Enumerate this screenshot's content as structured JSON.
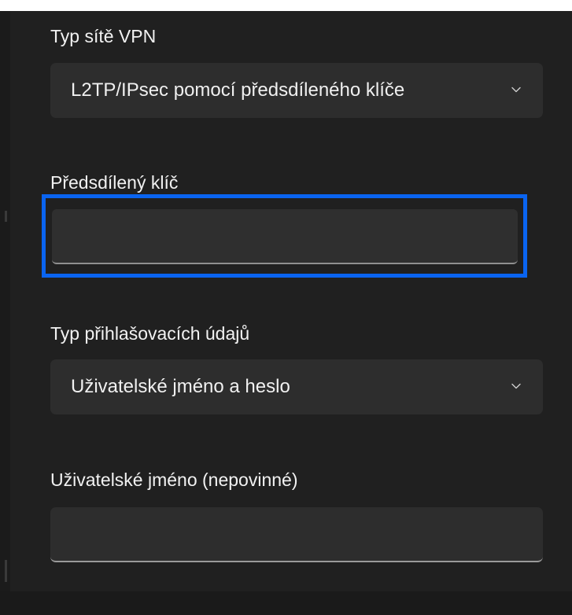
{
  "vpn_type": {
    "label": "Typ sítě VPN",
    "selected": "L2TP/IPsec pomocí předsdíleného klíče"
  },
  "preshared_key": {
    "label": "Předsdílený klíč",
    "value": ""
  },
  "sign_in_type": {
    "label": "Typ přihlašovacích údajů",
    "selected": "Uživatelské jméno a heslo"
  },
  "username": {
    "label": "Uživatelské jméno (nepovinné)",
    "value": ""
  },
  "colors": {
    "panel_background": "#202020",
    "control_background": "#2d2d2d",
    "focus_ring": "#0a64f0",
    "text": "#f2f2f2"
  },
  "icons": {
    "dropdown_chevron": "chevron-down-icon"
  }
}
